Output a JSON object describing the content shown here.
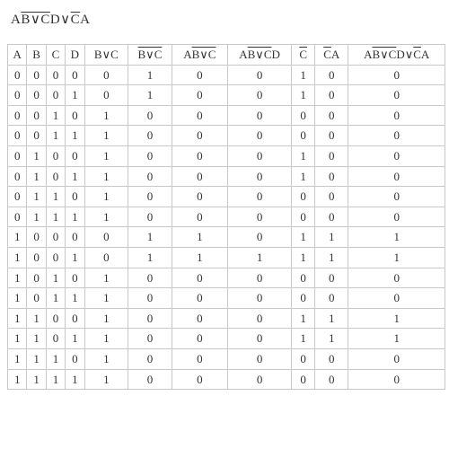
{
  "title": "A<o>B∨C</o>D∨<o>C</o>A",
  "headers": [
    "A",
    "B",
    "C",
    "D",
    "B∨C",
    "<o>B∨C</o>",
    "A<o>B∨C</o>",
    "A<o>B∨C</o>D",
    "<o>C</o>",
    "<o>C</o>A",
    "A<o>B∨C</o>D∨<o>C</o>A"
  ],
  "chart_data": {
    "type": "table",
    "columns": [
      "A",
      "B",
      "C",
      "D",
      "B∨C",
      "NOT(B∨C)",
      "A·NOT(B∨C)",
      "A·NOT(B∨C)·D",
      "NOT C",
      "NOT C·A",
      "A·NOT(B∨C)·D ∨ NOT C·A"
    ],
    "rows": [
      [
        0,
        0,
        0,
        0,
        0,
        1,
        0,
        0,
        1,
        0,
        0
      ],
      [
        0,
        0,
        0,
        1,
        0,
        1,
        0,
        0,
        1,
        0,
        0
      ],
      [
        0,
        0,
        1,
        0,
        1,
        0,
        0,
        0,
        0,
        0,
        0
      ],
      [
        0,
        0,
        1,
        1,
        1,
        0,
        0,
        0,
        0,
        0,
        0
      ],
      [
        0,
        1,
        0,
        0,
        1,
        0,
        0,
        0,
        1,
        0,
        0
      ],
      [
        0,
        1,
        0,
        1,
        1,
        0,
        0,
        0,
        1,
        0,
        0
      ],
      [
        0,
        1,
        1,
        0,
        1,
        0,
        0,
        0,
        0,
        0,
        0
      ],
      [
        0,
        1,
        1,
        1,
        1,
        0,
        0,
        0,
        0,
        0,
        0
      ],
      [
        1,
        0,
        0,
        0,
        0,
        1,
        1,
        0,
        1,
        1,
        1
      ],
      [
        1,
        0,
        0,
        1,
        0,
        1,
        1,
        1,
        1,
        1,
        1
      ],
      [
        1,
        0,
        1,
        0,
        1,
        0,
        0,
        0,
        0,
        0,
        0
      ],
      [
        1,
        0,
        1,
        1,
        1,
        0,
        0,
        0,
        0,
        0,
        0
      ],
      [
        1,
        1,
        0,
        0,
        1,
        0,
        0,
        0,
        1,
        1,
        1
      ],
      [
        1,
        1,
        0,
        1,
        1,
        0,
        0,
        0,
        1,
        1,
        1
      ],
      [
        1,
        1,
        1,
        0,
        1,
        0,
        0,
        0,
        0,
        0,
        0
      ],
      [
        1,
        1,
        1,
        1,
        1,
        0,
        0,
        0,
        0,
        0,
        0
      ]
    ]
  }
}
